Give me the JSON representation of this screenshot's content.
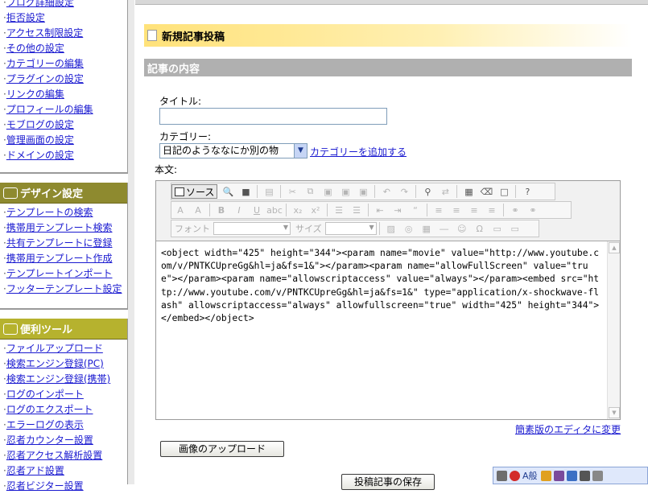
{
  "sidebar": {
    "box1_items": [
      "ブログ詳細設定",
      "拒否設定",
      "アクセス制限設定",
      "その他の設定",
      "カテゴリーの編集",
      "プラグインの設定",
      "リンクの編集",
      "プロフィールの編集",
      "モブログの設定",
      "管理画面の設定",
      "ドメインの設定"
    ],
    "design_title": "デザイン設定",
    "design_items": [
      "テンプレートの検索",
      "携帯用テンプレート検索",
      "共有テンプレートに登録",
      "携帯用テンプレート作成",
      "テンプレートインポート",
      "フッターテンプレート設定"
    ],
    "tools_title": "便利ツール",
    "tools_items": [
      "ファイルアップロード",
      "検索エンジン登録(PC)",
      "検索エンジン登録(携帯)",
      "ログのインポート",
      "ログのエクスポート",
      "エラーログの表示",
      "忍者カウンター設置",
      "忍者アクセス解析設置",
      "忍者アド設置",
      "忍者ビジター設置"
    ]
  },
  "main": {
    "page_title": "新規記事投稿",
    "section_title": "記事の内容",
    "title_label": "タイトル:",
    "title_value": "",
    "category_label": "カテゴリー:",
    "category_value": "日記のようななにか別の物",
    "add_category": "カテゴリーを追加する",
    "body_label": "本文:",
    "editor": {
      "source_label": "ソース",
      "font_label": "フォント",
      "size_label": "サイズ",
      "content": "<object width=\"425\" height=\"344\"><param name=\"movie\" value=\"http://www.youtube.com/v/PNTKCUpreGg&hl=ja&fs=1&\"></param><param name=\"allowFullScreen\" value=\"true\"></param><param name=\"allowscriptaccess\" value=\"always\"></param><embed src=\"http://www.youtube.com/v/PNTKCUpreGg&hl=ja&fs=1&\" type=\"application/x-shockwave-flash\" allowscriptaccess=\"always\" allowfullscreen=\"true\" width=\"425\" height=\"344\"></embed></object>"
    },
    "simple_editor_link": "簡素版のエディタに変更",
    "upload_button": "画像のアップロード",
    "save_button": "投稿記事の保存"
  },
  "langbar": {
    "mode": "A般"
  }
}
